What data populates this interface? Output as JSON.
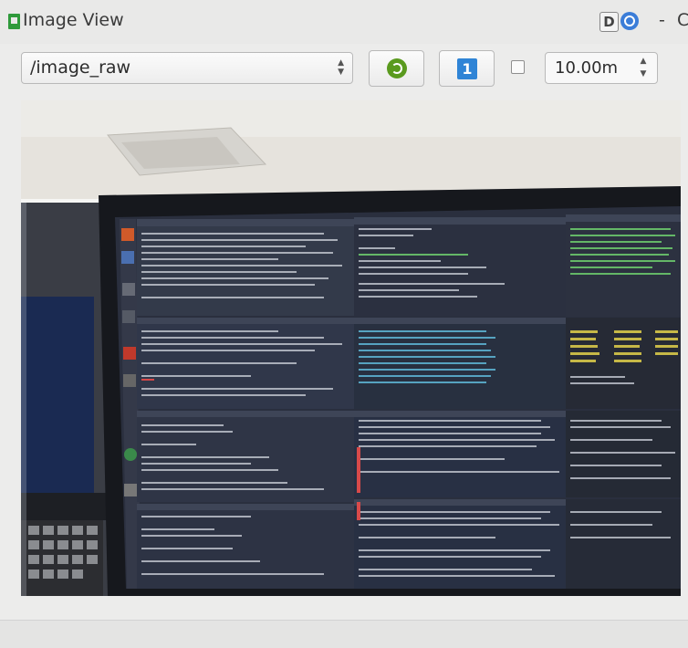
{
  "window": {
    "title": "Image View",
    "dock_btn_label": "D",
    "dash_label": "-",
    "close_label": "C"
  },
  "toolbar": {
    "topic_value": "/image_raw",
    "zoom_label": "1",
    "smooth_checked": false,
    "rotation_value": "10.00m"
  },
  "image": {
    "description_icon": "camera-image"
  }
}
